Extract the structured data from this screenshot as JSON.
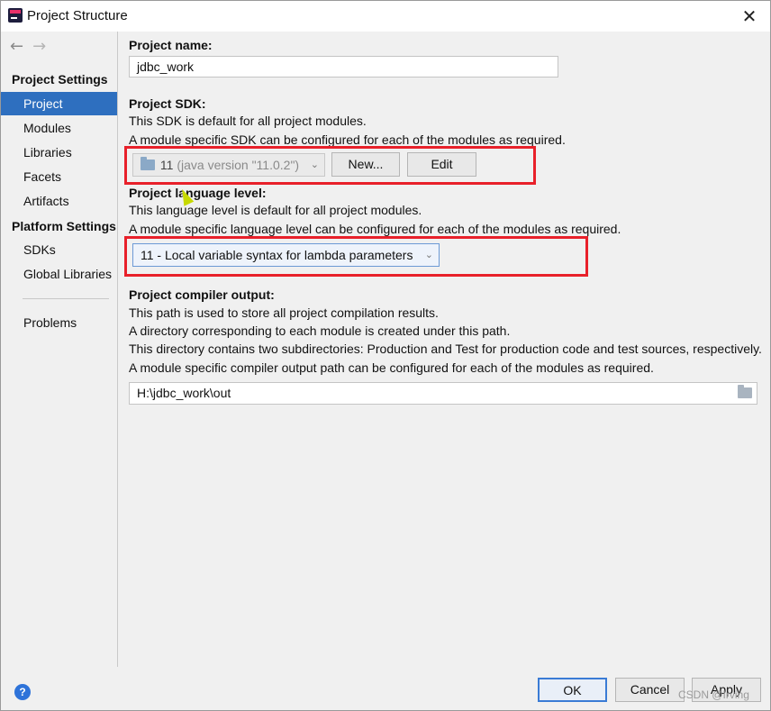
{
  "window": {
    "title": "Project Structure",
    "close_glyph": "✕"
  },
  "sidebar": {
    "back_glyph": "←",
    "forward_glyph": "→",
    "section_project_settings": "Project Settings",
    "section_platform_settings": "Platform Settings",
    "items": [
      {
        "label": "Project",
        "selected": true
      },
      {
        "label": "Modules"
      },
      {
        "label": "Libraries"
      },
      {
        "label": "Facets"
      },
      {
        "label": "Artifacts"
      },
      {
        "label": "SDKs"
      },
      {
        "label": "Global Libraries"
      },
      {
        "label": "Problems"
      }
    ]
  },
  "project_name": {
    "label": "Project name:",
    "value": "jdbc_work"
  },
  "project_sdk": {
    "label": "Project SDK:",
    "desc1": "This SDK is default for all project modules.",
    "desc2": "A module specific SDK can be configured for each of the modules as required.",
    "selected": "11",
    "selected_detail": "(java version \"11.0.2\")",
    "new_button": "New...",
    "edit_button": "Edit",
    "highlight_color": "#e8202a"
  },
  "language_level": {
    "label": "Project language level:",
    "desc1": "This language level is default for all project modules.",
    "desc2": "A module specific language level can be configured for each of the modules as required.",
    "selected": "11 - Local variable syntax for lambda parameters"
  },
  "compiler_output": {
    "label": "Project compiler output:",
    "desc1": "This path is used to store all project compilation results.",
    "desc2": "A directory corresponding to each module is created under this path.",
    "desc3": "This directory contains two subdirectories: Production and Test for production code and test sources, respectively.",
    "desc4": "A module specific compiler output path can be configured for each of the modules as required.",
    "path": "H:\\jdbc_work\\out"
  },
  "footer": {
    "help_glyph": "?",
    "ok_button": "OK",
    "cancel_button": "Cancel",
    "apply_button": "Apply",
    "watermark": "CSDN @Irving"
  },
  "icons": {
    "app": "intellij-idea-icon",
    "sdk": "folder-icon",
    "browse": "folder-open-icon",
    "help": "help-icon"
  },
  "colors": {
    "selection": "#2e6fbf",
    "highlight_box": "#e8202a",
    "primary_button_border": "#3a7bd5"
  }
}
